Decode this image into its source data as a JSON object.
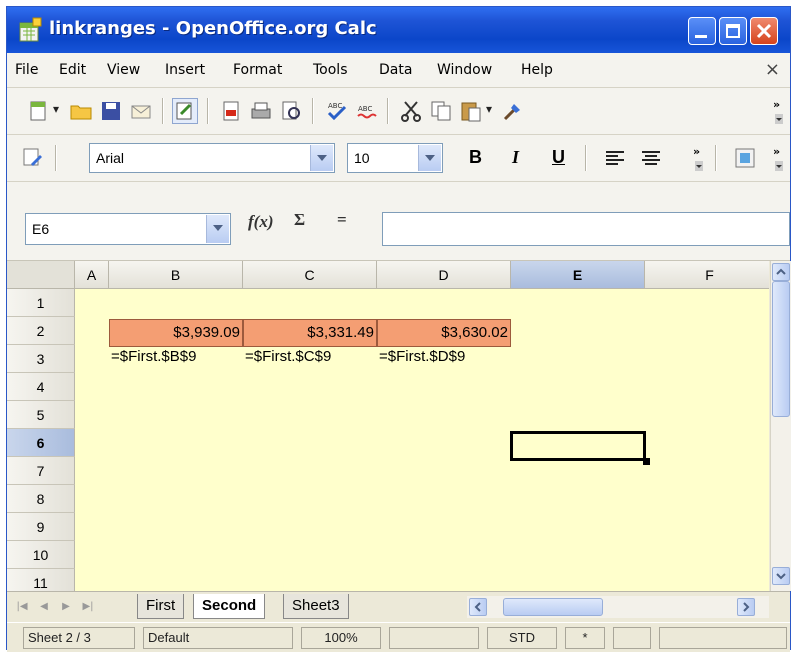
{
  "window": {
    "title": "linkranges - OpenOffice.org Calc"
  },
  "menu": [
    "File",
    "Edit",
    "View",
    "Insert",
    "Format",
    "Tools",
    "Data",
    "Window",
    "Help"
  ],
  "menu_close": "×",
  "formatting": {
    "font_name": "Arial",
    "font_size": "10",
    "bold": "B",
    "italic": "I",
    "underline": "U"
  },
  "formula_bar": {
    "cell_ref": "E6",
    "function_wizard": "f(x)",
    "sum": "Σ",
    "equals": "=",
    "content": ""
  },
  "grid": {
    "columns": [
      "A",
      "B",
      "C",
      "D",
      "E",
      "F"
    ],
    "rows": [
      "1",
      "2",
      "3",
      "4",
      "5",
      "6",
      "7",
      "8",
      "9",
      "10",
      "11"
    ],
    "selected_column": "E",
    "selected_row": "6",
    "row2": [
      "$3,939.09",
      "$3,331.49",
      "$3,630.02"
    ],
    "row3": [
      "=$First.$B$9",
      "=$First.$C$9",
      "=$First.$D$9"
    ]
  },
  "sheets": [
    "First",
    "Second",
    "Sheet3"
  ],
  "active_sheet": "Second",
  "status": {
    "sheet": "Sheet 2 / 3",
    "style": "Default",
    "zoom": "100%",
    "mode": "STD",
    "modified": "*"
  },
  "colors": {
    "title_bar": "#0b46c9",
    "cell_fill": "#f49e73",
    "sheet_background": "#ffffcc",
    "selection_header": "#a9bcdd"
  }
}
